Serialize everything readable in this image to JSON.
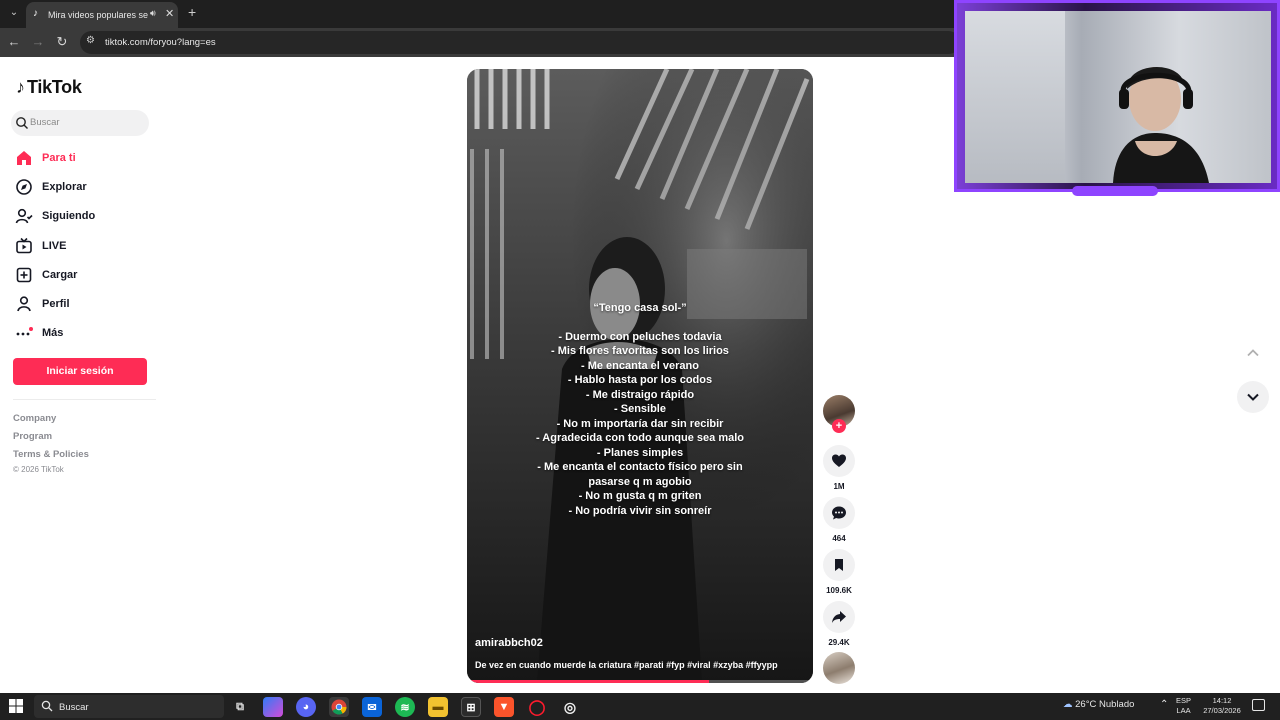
{
  "browser": {
    "tab_title": "Mira videos populares seleccionados para ti",
    "url": "tiktok.com/foryou?lang=es"
  },
  "sidebar": {
    "logo_text": "TikTok",
    "search_placeholder": "Buscar",
    "items": [
      {
        "label": "Para ti",
        "icon": "home-icon"
      },
      {
        "label": "Explorar",
        "icon": "compass-icon"
      },
      {
        "label": "Siguiendo",
        "icon": "following-icon"
      },
      {
        "label": "LIVE",
        "icon": "live-icon"
      },
      {
        "label": "Cargar",
        "icon": "upload-icon"
      },
      {
        "label": "Perfil",
        "icon": "profile-icon"
      },
      {
        "label": "Más",
        "icon": "more-icon"
      }
    ],
    "login_label": "Iniciar sesión",
    "footer": [
      "Company",
      "Program",
      "Terms & Policies"
    ],
    "copyright": "© 2026 TikTok"
  },
  "video": {
    "caption_title": "“Tengo casa sol-”",
    "caption_lines": [
      "- Duermo con peluches todavia",
      "- Mis flores favoritas son los lirios",
      "- Me encanta el verano",
      "- Hablo hasta por los codos",
      "- Me distraigo rápido",
      "- Sensible",
      "- No m importaría dar sin recibir",
      "- Agradecida con todo aunque sea malo",
      "- Planes simples",
      "- Me encanta el contacto físico pero sin",
      "pasarse q m agobio",
      "- No m gusta q m griten",
      "- No podría vivir sin sonreír"
    ],
    "username": "amirabbch02",
    "description": "De vez en cuando muerde la criatura #parati #fyp #viral #xzyba #ffyypp",
    "progress": 0.7
  },
  "actions": {
    "likes": "1M",
    "comments": "464",
    "saves": "109.6K",
    "shares": "29.4K"
  },
  "taskbar": {
    "search_label": "Buscar",
    "weather": "26°C  Nublado",
    "lang_top": "ESP",
    "lang_bottom": "LAA",
    "time": "14:12",
    "date": "27/03/2026"
  },
  "colors": {
    "accent": "#fe2c55",
    "webcam_frame": "#8e44ff"
  }
}
